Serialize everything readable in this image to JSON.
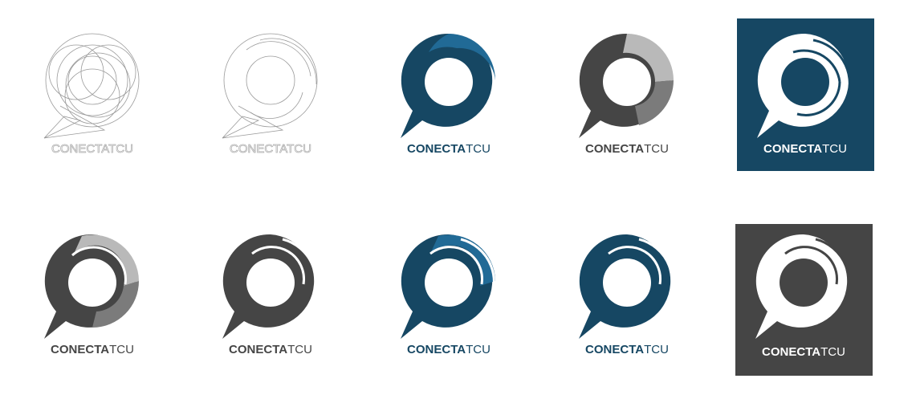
{
  "colors": {
    "navy": "#164763",
    "blue": "#216a96",
    "dark_gray": "#454545",
    "mid_gray": "#7b7b7b",
    "light_gray": "#b9b9b9",
    "outline": "#9a9a9a",
    "white": "#ffffff"
  },
  "logos": [
    {
      "id": "construction-grid",
      "style": "construction",
      "wordmark_bold": "CONECTA",
      "wordmark_light": "TCU",
      "text_color": "#b0b0b0"
    },
    {
      "id": "construction-outline",
      "style": "outline",
      "wordmark_bold": "CONECTA",
      "wordmark_light": "TCU",
      "text_color": "#b0b0b0"
    },
    {
      "id": "blue-flat",
      "style": "flat-blue",
      "wordmark_bold": "CONECTA",
      "wordmark_light": "TCU",
      "text_color": "#164763"
    },
    {
      "id": "gray-flat",
      "style": "flat-gray",
      "wordmark_bold": "CONECTA",
      "wordmark_light": "TCU",
      "text_color": "#454545"
    },
    {
      "id": "white-on-navy",
      "style": "white-on-navy",
      "wordmark_bold": "CONECTA",
      "wordmark_light": "TCU",
      "text_color": "#ffffff"
    },
    {
      "id": "gray-segmented",
      "style": "segmented-gray",
      "wordmark_bold": "CONECTA",
      "wordmark_light": "TCU",
      "text_color": "#454545"
    },
    {
      "id": "gray-mono",
      "style": "mono-gray",
      "wordmark_bold": "CONECTA",
      "wordmark_light": "TCU",
      "text_color": "#454545"
    },
    {
      "id": "blue-segmented",
      "style": "segmented-blue",
      "wordmark_bold": "CONECTA",
      "wordmark_light": "TCU",
      "text_color": "#164763"
    },
    {
      "id": "navy-mono",
      "style": "mono-navy",
      "wordmark_bold": "CONECTA",
      "wordmark_light": "TCU",
      "text_color": "#164763"
    },
    {
      "id": "white-on-gray",
      "style": "white-on-gray",
      "wordmark_bold": "CONECTA",
      "wordmark_light": "TCU",
      "text_color": "#ffffff"
    }
  ]
}
